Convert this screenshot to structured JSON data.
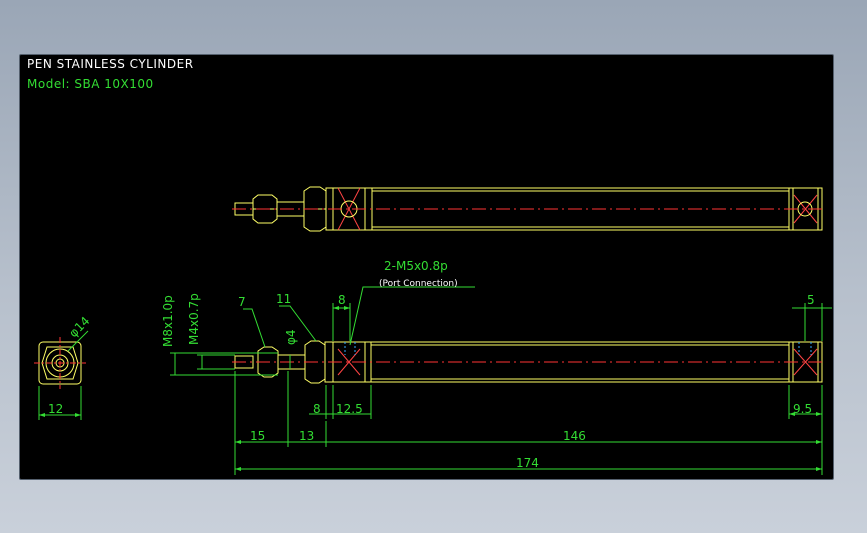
{
  "title": "PEN STAINLESS CYLINDER",
  "model": "Model: SBA 10X100",
  "colors": {
    "background": "#000000",
    "outline": "#ffff66",
    "dimension": "#33dd33",
    "centerline": "#ff3333",
    "text": "#ffffff",
    "hidden": "#33aaff"
  },
  "callouts": {
    "port_spec": "2-M5x0.8p",
    "port_note": "(Port Connection)",
    "leader_7": "7",
    "leader_11": "11"
  },
  "dimensions": {
    "rod_thread": "M8x1.0p",
    "tip_thread": "M4x0.7p",
    "rod_dia": "φ4",
    "end_dia": "φ14",
    "end_width": "12",
    "head_len": "8",
    "port_pos": "8",
    "port_offset": "12.5",
    "rear_port": "5",
    "rear_len": "9.5",
    "rod_ext": "15",
    "nut_len": "13",
    "body_len": "146",
    "total_len": "174"
  }
}
